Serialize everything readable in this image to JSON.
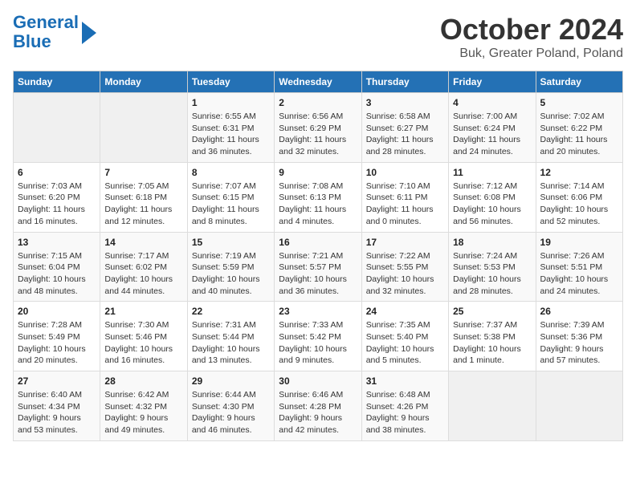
{
  "header": {
    "logo_line1": "General",
    "logo_line2": "Blue",
    "month_title": "October 2024",
    "location": "Buk, Greater Poland, Poland"
  },
  "days_of_week": [
    "Sunday",
    "Monday",
    "Tuesday",
    "Wednesday",
    "Thursday",
    "Friday",
    "Saturday"
  ],
  "weeks": [
    [
      null,
      null,
      {
        "day": "1",
        "sunrise": "6:55 AM",
        "sunset": "6:31 PM",
        "daylight": "11 hours and 36 minutes."
      },
      {
        "day": "2",
        "sunrise": "6:56 AM",
        "sunset": "6:29 PM",
        "daylight": "11 hours and 32 minutes."
      },
      {
        "day": "3",
        "sunrise": "6:58 AM",
        "sunset": "6:27 PM",
        "daylight": "11 hours and 28 minutes."
      },
      {
        "day": "4",
        "sunrise": "7:00 AM",
        "sunset": "6:24 PM",
        "daylight": "11 hours and 24 minutes."
      },
      {
        "day": "5",
        "sunrise": "7:02 AM",
        "sunset": "6:22 PM",
        "daylight": "11 hours and 20 minutes."
      }
    ],
    [
      {
        "day": "6",
        "sunrise": "7:03 AM",
        "sunset": "6:20 PM",
        "daylight": "11 hours and 16 minutes."
      },
      {
        "day": "7",
        "sunrise": "7:05 AM",
        "sunset": "6:18 PM",
        "daylight": "11 hours and 12 minutes."
      },
      {
        "day": "8",
        "sunrise": "7:07 AM",
        "sunset": "6:15 PM",
        "daylight": "11 hours and 8 minutes."
      },
      {
        "day": "9",
        "sunrise": "7:08 AM",
        "sunset": "6:13 PM",
        "daylight": "11 hours and 4 minutes."
      },
      {
        "day": "10",
        "sunrise": "7:10 AM",
        "sunset": "6:11 PM",
        "daylight": "11 hours and 0 minutes."
      },
      {
        "day": "11",
        "sunrise": "7:12 AM",
        "sunset": "6:08 PM",
        "daylight": "10 hours and 56 minutes."
      },
      {
        "day": "12",
        "sunrise": "7:14 AM",
        "sunset": "6:06 PM",
        "daylight": "10 hours and 52 minutes."
      }
    ],
    [
      {
        "day": "13",
        "sunrise": "7:15 AM",
        "sunset": "6:04 PM",
        "daylight": "10 hours and 48 minutes."
      },
      {
        "day": "14",
        "sunrise": "7:17 AM",
        "sunset": "6:02 PM",
        "daylight": "10 hours and 44 minutes."
      },
      {
        "day": "15",
        "sunrise": "7:19 AM",
        "sunset": "5:59 PM",
        "daylight": "10 hours and 40 minutes."
      },
      {
        "day": "16",
        "sunrise": "7:21 AM",
        "sunset": "5:57 PM",
        "daylight": "10 hours and 36 minutes."
      },
      {
        "day": "17",
        "sunrise": "7:22 AM",
        "sunset": "5:55 PM",
        "daylight": "10 hours and 32 minutes."
      },
      {
        "day": "18",
        "sunrise": "7:24 AM",
        "sunset": "5:53 PM",
        "daylight": "10 hours and 28 minutes."
      },
      {
        "day": "19",
        "sunrise": "7:26 AM",
        "sunset": "5:51 PM",
        "daylight": "10 hours and 24 minutes."
      }
    ],
    [
      {
        "day": "20",
        "sunrise": "7:28 AM",
        "sunset": "5:49 PM",
        "daylight": "10 hours and 20 minutes."
      },
      {
        "day": "21",
        "sunrise": "7:30 AM",
        "sunset": "5:46 PM",
        "daylight": "10 hours and 16 minutes."
      },
      {
        "day": "22",
        "sunrise": "7:31 AM",
        "sunset": "5:44 PM",
        "daylight": "10 hours and 13 minutes."
      },
      {
        "day": "23",
        "sunrise": "7:33 AM",
        "sunset": "5:42 PM",
        "daylight": "10 hours and 9 minutes."
      },
      {
        "day": "24",
        "sunrise": "7:35 AM",
        "sunset": "5:40 PM",
        "daylight": "10 hours and 5 minutes."
      },
      {
        "day": "25",
        "sunrise": "7:37 AM",
        "sunset": "5:38 PM",
        "daylight": "10 hours and 1 minute."
      },
      {
        "day": "26",
        "sunrise": "7:39 AM",
        "sunset": "5:36 PM",
        "daylight": "9 hours and 57 minutes."
      }
    ],
    [
      {
        "day": "27",
        "sunrise": "6:40 AM",
        "sunset": "4:34 PM",
        "daylight": "9 hours and 53 minutes."
      },
      {
        "day": "28",
        "sunrise": "6:42 AM",
        "sunset": "4:32 PM",
        "daylight": "9 hours and 49 minutes."
      },
      {
        "day": "29",
        "sunrise": "6:44 AM",
        "sunset": "4:30 PM",
        "daylight": "9 hours and 46 minutes."
      },
      {
        "day": "30",
        "sunrise": "6:46 AM",
        "sunset": "4:28 PM",
        "daylight": "9 hours and 42 minutes."
      },
      {
        "day": "31",
        "sunrise": "6:48 AM",
        "sunset": "4:26 PM",
        "daylight": "9 hours and 38 minutes."
      },
      null,
      null
    ]
  ]
}
